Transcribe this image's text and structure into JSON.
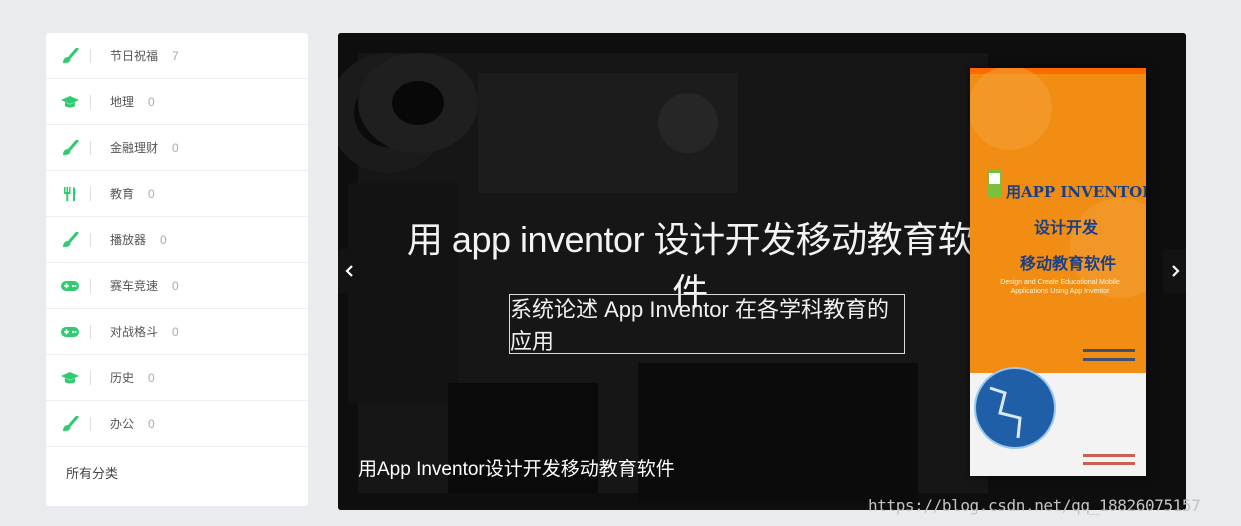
{
  "sidebar": {
    "items": [
      {
        "label": "节日祝福",
        "count": "7",
        "icon": "brush-icon"
      },
      {
        "label": "地理",
        "count": "0",
        "icon": "graduation-cap-icon"
      },
      {
        "label": "金融理财",
        "count": "0",
        "icon": "brush-icon"
      },
      {
        "label": "教育",
        "count": "0",
        "icon": "cutlery-icon"
      },
      {
        "label": "播放器",
        "count": "0",
        "icon": "brush-icon"
      },
      {
        "label": "赛车竞速",
        "count": "0",
        "icon": "gamepad-icon"
      },
      {
        "label": "对战格斗",
        "count": "0",
        "icon": "gamepad-icon"
      },
      {
        "label": "历史",
        "count": "0",
        "icon": "graduation-cap-icon"
      },
      {
        "label": "办公",
        "count": "0",
        "icon": "brush-icon"
      }
    ],
    "all_label": "所有分类"
  },
  "carousel": {
    "headline": "用 app inventor 设计开发移动教育软件",
    "subline": "系统论述 App Inventor 在各学科教育的应用",
    "caption": "用App Inventor设计开发移动教育软件",
    "book": {
      "title": "用APP INVENTOR",
      "sub1": "设计开发",
      "sub2": "移动教育软件",
      "english": "Design and Create Educational Mobile Applications Using App Inventor"
    }
  },
  "watermark": "https://blog.csdn.net/qq_18826075157",
  "colors": {
    "icon": "#2ecc71",
    "page_bg": "#e9ebef",
    "book_orange": "#f08d12",
    "book_blue": "#1a3f86"
  }
}
